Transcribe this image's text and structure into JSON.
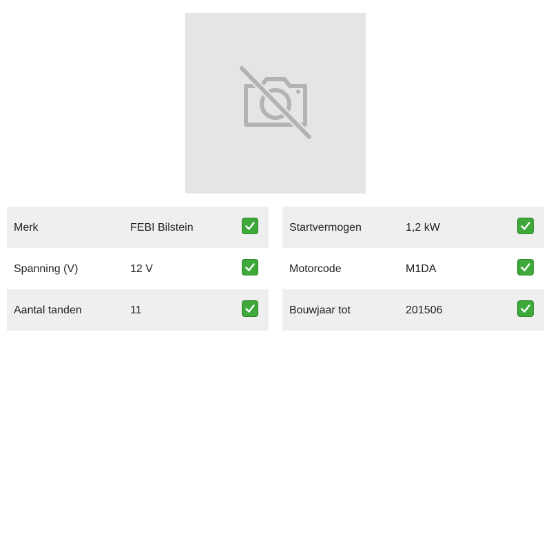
{
  "product_image": {
    "icon": "camera-off-icon",
    "placeholder_color": "#e5e5e5"
  },
  "specs_left": [
    {
      "label": "Merk",
      "value": "FEBI Bilstein",
      "status": "check-icon"
    },
    {
      "label": "Spanning (V)",
      "value": "12 V",
      "status": "check-icon"
    },
    {
      "label": "Aantal tanden",
      "value": "11",
      "status": "check-icon"
    }
  ],
  "specs_right": [
    {
      "label": "Startvermogen",
      "value": "1,2 kW",
      "status": "check-icon"
    },
    {
      "label": "Motorcode",
      "value": "M1DA",
      "status": "check-icon"
    },
    {
      "label": "Bouwjaar tot",
      "value": "201506",
      "status": "check-icon"
    }
  ],
  "colors": {
    "row_shaded": "#efefef",
    "check_green": "#3fa83a"
  }
}
